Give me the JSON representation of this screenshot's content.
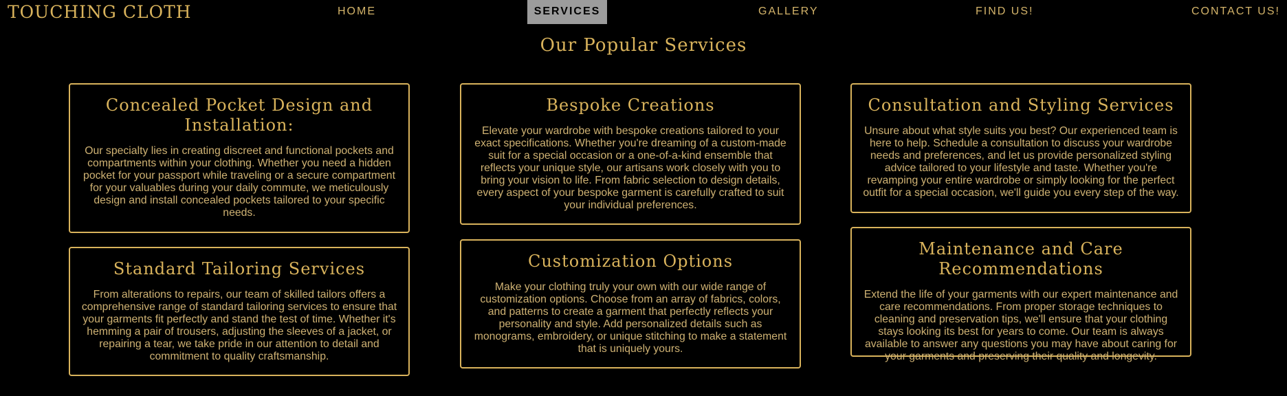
{
  "header": {
    "logo": "TOUCHING CLOTH",
    "nav": [
      {
        "label": "HOME"
      },
      {
        "label": "SERVICES",
        "active": true
      },
      {
        "label": "GALLERY"
      },
      {
        "label": "FIND US!"
      },
      {
        "label": "CONTACT US!"
      }
    ]
  },
  "main": {
    "title": "Our Popular Services",
    "services": [
      {
        "title": "Concealed Pocket Design and Installation:",
        "text": "Our specialty lies in creating discreet and functional pockets and compartments within your clothing. Whether you need a hidden pocket for your passport while traveling or a secure compartment for your valuables during your daily commute, we meticulously design and install concealed pockets tailored to your specific needs."
      },
      {
        "title": "Standard Tailoring Services",
        "text": "From alterations to repairs, our team of skilled tailors offers a comprehensive range of standard tailoring services to ensure that your garments fit perfectly and stand the test of time. Whether it's hemming a pair of trousers, adjusting the sleeves of a jacket, or repairing a tear, we take pride in our attention to detail and commitment to quality craftsmanship."
      },
      {
        "title": "Bespoke Creations",
        "text": "Elevate your wardrobe with bespoke creations tailored to your exact specifications. Whether you're dreaming of a custom-made suit for a special occasion or a one-of-a-kind ensemble that reflects your unique style, our artisans work closely with you to bring your vision to life. From fabric selection to design details, every aspect of your bespoke garment is carefully crafted to suit your individual preferences."
      },
      {
        "title": "Customization Options",
        "text": "Make your clothing truly your own with our wide range of customization options. Choose from an array of fabrics, colors, and patterns to create a garment that perfectly reflects your personality and style. Add personalized details such as monograms, embroidery, or unique stitching to make a statement that is uniquely yours."
      },
      {
        "title": "Consultation and Styling Services",
        "text": "Unsure about what style suits you best? Our experienced team is here to help. Schedule a consultation to discuss your wardrobe needs and preferences, and let us provide personalized styling advice tailored to your lifestyle and taste. Whether you're revamping your entire wardrobe or simply looking for the perfect outfit for a special occasion, we'll guide you every step of the way."
      },
      {
        "title": "Maintenance and Care Recommendations",
        "text": "Extend the life of your garments with our expert maintenance and care recommendations. From proper storage techniques to cleaning and preservation tips, we'll ensure that your clothing stays looking its best for years to come. Our team is always available to answer any questions you may have about caring for your garments and preserving their quality and longevity."
      }
    ]
  },
  "colors": {
    "background": "#000000",
    "accent": "#d9b35c",
    "text": "#cfb273",
    "active_nav_bg": "#9c9c9c"
  }
}
